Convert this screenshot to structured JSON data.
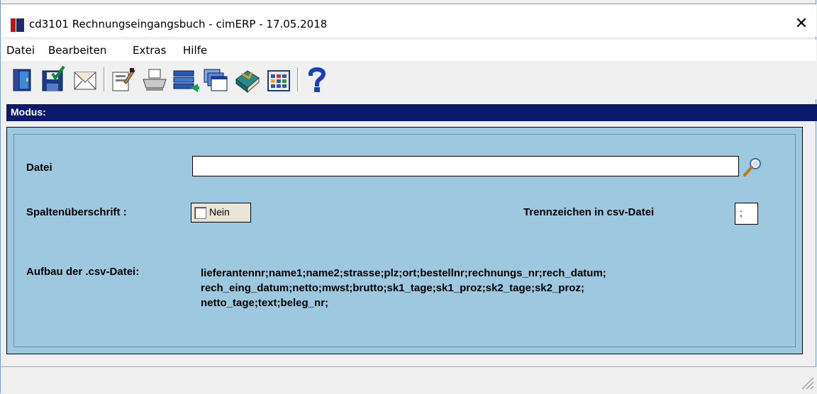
{
  "window": {
    "title": "cd3101 Rechnungseingangsbuch - cimERP - 17.05.2018",
    "close_label": "✕"
  },
  "menu": {
    "items": [
      "Datei",
      "Bearbeiten",
      "Extras",
      "Hilfe"
    ]
  },
  "toolbar": {
    "buttons": [
      {
        "icon": "exit-door-icon"
      },
      {
        "icon": "save-floppy-icon"
      },
      {
        "icon": "mail-envelope-icon"
      },
      {
        "icon": "edit-properties-icon"
      },
      {
        "icon": "printer-icon"
      },
      {
        "icon": "import-list-icon"
      },
      {
        "icon": "windows-cascade-icon"
      },
      {
        "icon": "book-icon"
      },
      {
        "icon": "grid-calendar-icon"
      },
      {
        "icon": "help-question-icon"
      }
    ]
  },
  "modus": {
    "label": "Modus:"
  },
  "form": {
    "datei_label": "Datei",
    "datei_value": "",
    "spalten_label": "Spaltenüberschrift :",
    "spalten_checkbox_label": "Nein",
    "spalten_checked": false,
    "trenn_label": "Trennzeichen in csv-Datei",
    "trenn_value": ";",
    "aufbau_label": "Aufbau der .csv-Datei:",
    "aufbau_lines": [
      "lieferantennr;name1;name2;strasse;plz;ort;bestellnr;rechnungs_nr;rech_datum;",
      "rech_eing_datum;netto;mwst;brutto;sk1_tage;sk1_proz;sk2_tage;sk2_proz;",
      "netto_tage;text;beleg_nr;"
    ]
  },
  "colors": {
    "modus_bar": "#0b1a6b",
    "panel_bg": "#9ec8e0",
    "app_icon_red": "#c0141c",
    "app_icon_navy": "#1a2a6c"
  }
}
